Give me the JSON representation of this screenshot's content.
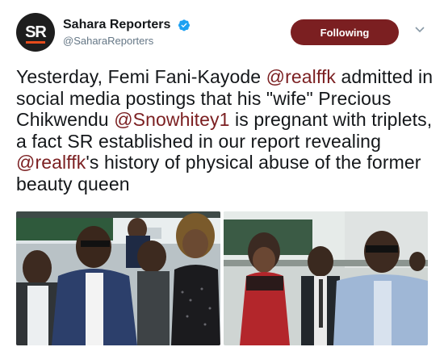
{
  "account": {
    "display_name": "Sahara Reporters",
    "handle": "@SaharaReporters",
    "avatar_text": "SR",
    "verified": true
  },
  "follow_button": {
    "label": "Following"
  },
  "tweet": {
    "segments": [
      {
        "text": "Yesterday, Femi Fani-Kayode ",
        "mention": false
      },
      {
        "text": "@realffk",
        "mention": true
      },
      {
        "text": " admitted in social media postings that his \"wife\" Precious Chikwendu ",
        "mention": false
      },
      {
        "text": "@Snowhitey1",
        "mention": true
      },
      {
        "text": " is pregnant with triplets, a fact SR established in our report revealing ",
        "mention": false
      },
      {
        "text": "@realffk",
        "mention": true
      },
      {
        "text": "'s history of physical abuse of the former beauty queen",
        "mention": false
      }
    ]
  },
  "media": [
    {
      "name": "photo-left"
    },
    {
      "name": "photo-right"
    }
  ],
  "colors": {
    "brand": "#7b1f21",
    "verified": "#1da1f2",
    "secondary_text": "#657786"
  },
  "icons": [
    "verified-badge-icon",
    "chevron-down-icon"
  ]
}
